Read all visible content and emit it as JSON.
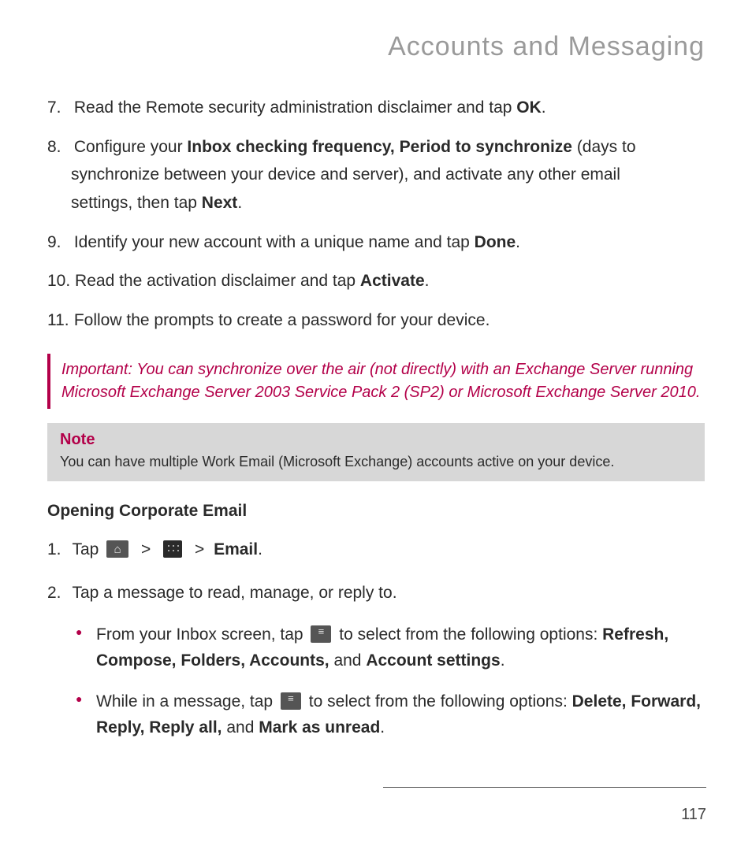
{
  "chapter_title": "Accounts and Messaging",
  "steps": [
    {
      "num": "7.",
      "pre": "Read the Remote security administration disclaimer and tap ",
      "bold": "OK",
      "post": "."
    },
    {
      "num": "8.",
      "line1_pre": "Configure your ",
      "line1_bold": "Inbox checking frequency, Period to synchronize",
      "line1_post": " (days to",
      "line2": "synchronize between your device and server), and activate any other email",
      "line3_pre": "settings, then tap ",
      "line3_bold": "Next",
      "line3_post": "."
    },
    {
      "num": "9.",
      "pre": "Identify your new account with a unique name and tap ",
      "bold": "Done",
      "post": "."
    },
    {
      "num": "10.",
      "pre": "Read the activation disclaimer and tap ",
      "bold": "Activate",
      "post": "."
    },
    {
      "num": "11.",
      "pre": "Follow the prompts to create a password for your device.",
      "bold": "",
      "post": ""
    }
  ],
  "important": {
    "label": "Important:",
    "text": "  You can synchronize over the air (not directly) with an Exchange Server running Microsoft Exchange Server 2003 Service Pack 2 (SP2) or Microsoft Exchange Server 2010."
  },
  "note": {
    "title": "Note",
    "body": "You can have multiple Work Email (Microsoft Exchange) accounts active on your device."
  },
  "section_heading": "Opening Corporate Email",
  "open_steps": {
    "s1": {
      "num": "1.",
      "tap": "Tap ",
      "sep": ">",
      "email_bold": "Email",
      "end": "."
    },
    "s2": {
      "num": "2.",
      "text": "Tap a message to read, manage, or reply to."
    }
  },
  "bullets": {
    "b1": {
      "pre": "From your Inbox screen, tap ",
      "mid": " to select from the following options: ",
      "bold": "Refresh, Compose, Folders, Accounts,",
      "and": " and ",
      "bold2": "Account settings",
      "end": "."
    },
    "b2": {
      "pre": "While in a message, tap ",
      "mid": " to select from the following options: ",
      "bold": "Delete, Forward, Reply, Reply all,",
      "and": " and ",
      "bold2": "Mark as unread",
      "end": "."
    }
  },
  "page_number": "117"
}
